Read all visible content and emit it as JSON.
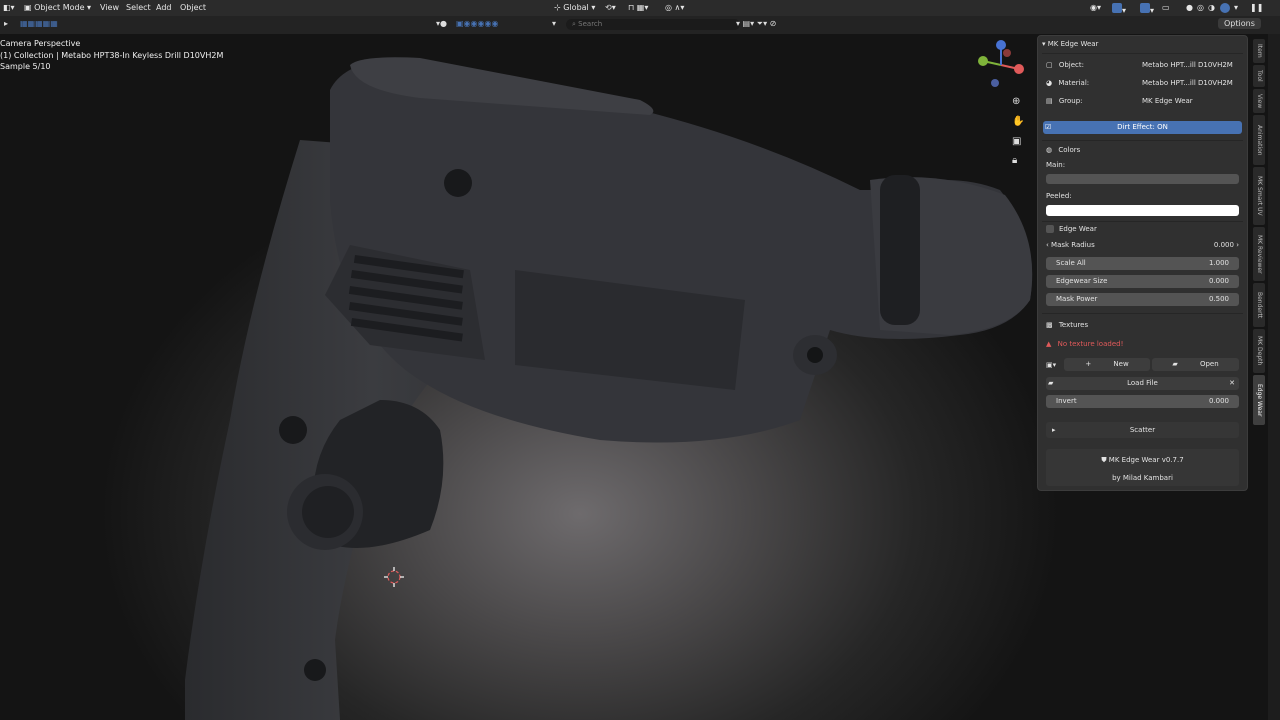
{
  "header": {
    "mode_label": "Object Mode",
    "menu": [
      "View",
      "Select",
      "Add",
      "Object"
    ],
    "orientation_label": "Global",
    "search_placeholder": "Search",
    "options_label": "Options"
  },
  "viewport": {
    "overlay_lines": [
      "Camera Perspective",
      "(1) Collection | Metabo HPT38-In Keyless Drill D10VH2M",
      "Sample 5/10"
    ]
  },
  "panel": {
    "title": "MK Edge Wear",
    "info": [
      {
        "label": "Object:",
        "value": "Metabo HPT...ill D10VH2M"
      },
      {
        "label": "Material:",
        "value": "Metabo HPT...ill D10VH2M"
      },
      {
        "label": "Group:",
        "value": "MK Edge Wear"
      }
    ],
    "dirt_effect_label": "Dirt Effect: ON",
    "colors_header": "Colors",
    "main_label": "Main:",
    "peeled_label": "Peeled:",
    "edge_wear_label": "Edge Wear",
    "mask_radius": {
      "label": "Mask Radius",
      "value": "0.000"
    },
    "sliders": [
      {
        "label": "Scale All",
        "value": "1.000"
      },
      {
        "label": "Edgewear Size",
        "value": "0.000"
      },
      {
        "label": "Mask Power",
        "value": "0.500"
      }
    ],
    "textures_header": "Textures",
    "no_texture_msg": "No texture loaded!",
    "new_label": "New",
    "open_label": "Open",
    "load_file_label": "Load File",
    "invert": {
      "label": "Invert",
      "value": "0.000"
    },
    "scatter_label": "Scatter",
    "footer_title": "MK Edge Wear  v0.7.7",
    "footer_author": "by Milad Kambari"
  },
  "tabs": [
    "Item",
    "Tool",
    "View",
    "Animation",
    "MK Smart UV",
    "MK Reviewer",
    "Bendertt",
    "MK Depth",
    "Edge Wear"
  ],
  "colors": {
    "accent": "#4772b3",
    "peeled": "#ffffff",
    "main": "#545454",
    "warning": "#e05a5a"
  }
}
